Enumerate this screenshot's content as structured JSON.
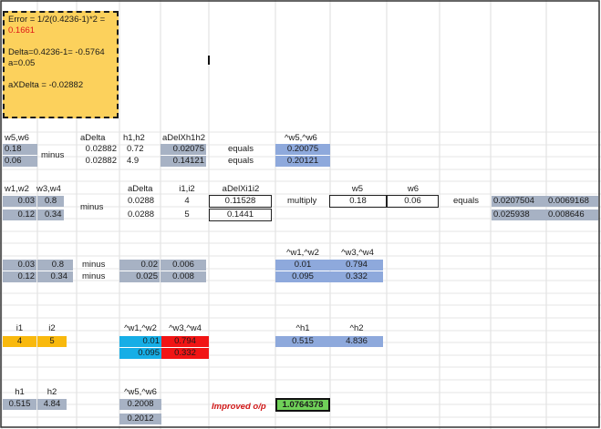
{
  "note": {
    "line1": "Error = 1/2(0.4236-1)*2 =",
    "line1_value": "0.1661",
    "line2": "Delta=0.4236-1= -0.5764",
    "line3": "a=0.05",
    "line4": "aXDelta = -0.02882"
  },
  "block1": {
    "w5w6_header": "w5,w6",
    "w5": "0.18",
    "w6": "0.06",
    "minus": "minus",
    "adelta_header": "aDelta",
    "adelta": [
      "0.02882",
      "0.02882"
    ],
    "h1h2_header": "h1,h2",
    "h": [
      "0.72",
      "4.9"
    ],
    "adelxh_header": "aDelXh1h2",
    "adelxh": [
      "0.02075",
      "0.14121"
    ],
    "equals": [
      "equals",
      "equals"
    ],
    "neww_header": "^w5,^w6",
    "neww": [
      "0.20075",
      "0.20121"
    ]
  },
  "block2": {
    "w_header": "w1,w2",
    "w34_header": "w3,w4",
    "w": [
      [
        "0.03",
        "0.8"
      ],
      [
        "0.12",
        "0.34"
      ]
    ],
    "minus": "minus",
    "adelta_header": "aDelta",
    "adelta": [
      "0.0288",
      "0.0288"
    ],
    "i_header": "i1,i2",
    "i": [
      "4",
      "5"
    ],
    "adelxi_header": "aDelXi1i2",
    "adelxi": [
      "0.11528",
      "0.1441"
    ],
    "multiply": "multiply",
    "w5_header": "w5",
    "w6_header": "w6",
    "w5": "0.18",
    "w6": "0.06",
    "equals": "equals",
    "result": [
      [
        "0.0207504",
        "0.0069168"
      ],
      [
        "0.025938",
        "0.008646"
      ]
    ]
  },
  "block3": {
    "w": [
      [
        "0.03",
        "0.8"
      ],
      [
        "0.12",
        "0.34"
      ]
    ],
    "minus": [
      "minus",
      "minus"
    ],
    "sub": [
      [
        "0.02",
        "0.006"
      ],
      [
        "0.025",
        "0.008"
      ]
    ],
    "neww12_header": "^w1,^w2",
    "neww34_header": "^w3,^w4",
    "neww": [
      [
        "0.01",
        "0.794"
      ],
      [
        "0.095",
        "0.332"
      ]
    ]
  },
  "block4": {
    "i1_header": "i1",
    "i2_header": "i2",
    "i1": "4",
    "i2": "5",
    "neww12_header": "^w1,^w2",
    "neww34_header": "^w3,^w4",
    "neww12": [
      "0.01",
      "0.095"
    ],
    "neww34": [
      "0.794",
      "0.332"
    ],
    "h1_header": "^h1",
    "h2_header": "^h2",
    "h1": "0.515",
    "h2": "4.836"
  },
  "block5": {
    "h1_header": "h1",
    "h2_header": "h2",
    "h1": "0.515",
    "h2": "4.84",
    "w_header": "^w5,^w6",
    "w": [
      "0.2008",
      "0.2012"
    ],
    "improved_label": "Improved o/p",
    "improved_value": "1.0764378"
  },
  "colors": {
    "note_bg": "#fcd15c",
    "gray": "#a7b2c4",
    "blue": "#8ea9dc",
    "cyan": "#16aee6",
    "red": "#f11414",
    "orange": "#f9b90d",
    "green": "#6fd158"
  }
}
